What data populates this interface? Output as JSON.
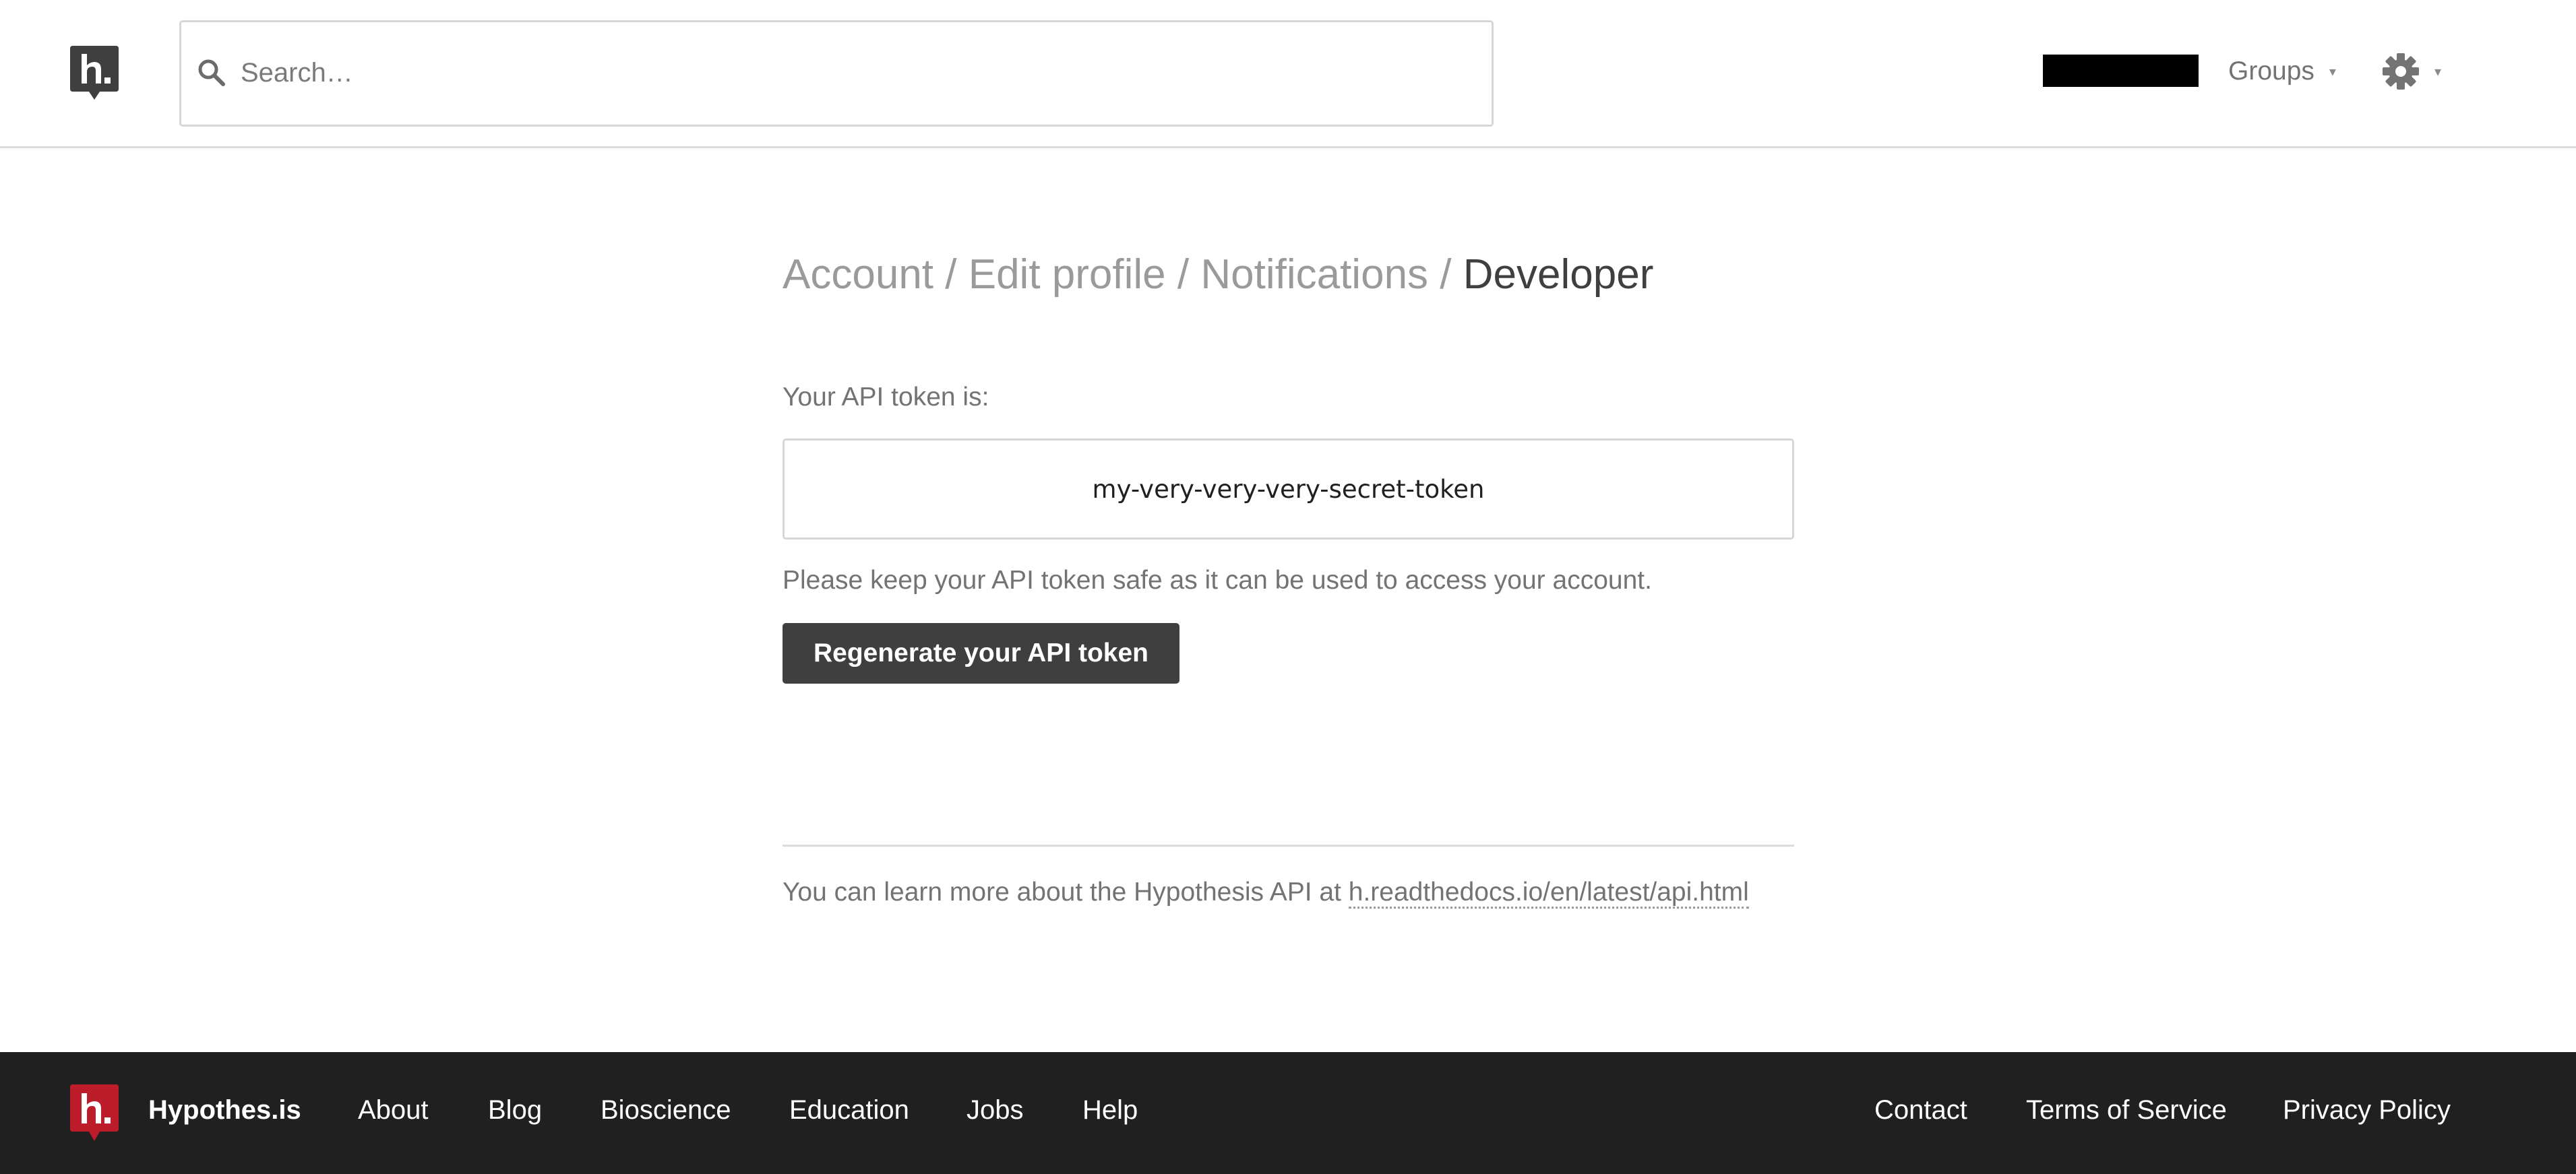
{
  "header": {
    "search": {
      "placeholder": "Search…",
      "value": ""
    },
    "groups_label": "Groups",
    "caret_glyph": "▾"
  },
  "breadcrumb": {
    "items": [
      "Account",
      "Edit profile",
      "Notifications"
    ],
    "current": "Developer",
    "separator": "/"
  },
  "developer": {
    "token_label": "Your API token is:",
    "token_value": "my-very-very-very-secret-token",
    "warning": "Please keep your API token safe as it can be used to access your account.",
    "regenerate_label": "Regenerate your API token",
    "learn_more_prefix": "You can learn more about the Hypothesis API at",
    "learn_more_link": "h.readthedocs.io/en/latest/api.html"
  },
  "footer": {
    "brand": "Hypothes.is",
    "left_links": [
      "About",
      "Blog",
      "Bioscience",
      "Education",
      "Jobs",
      "Help"
    ],
    "right_links": [
      "Contact",
      "Terms of Service",
      "Privacy Policy"
    ]
  },
  "colors": {
    "brand_dark": "#3f3f3f",
    "brand_red": "#bd1c2b",
    "footer_bg": "#202020",
    "muted_text": "#737373"
  },
  "icons": {
    "header_logo": "hypothesis-logo-icon",
    "search": "search-icon",
    "settings": "gear-icon",
    "footer_logo": "hypothesis-logo-red-icon"
  }
}
